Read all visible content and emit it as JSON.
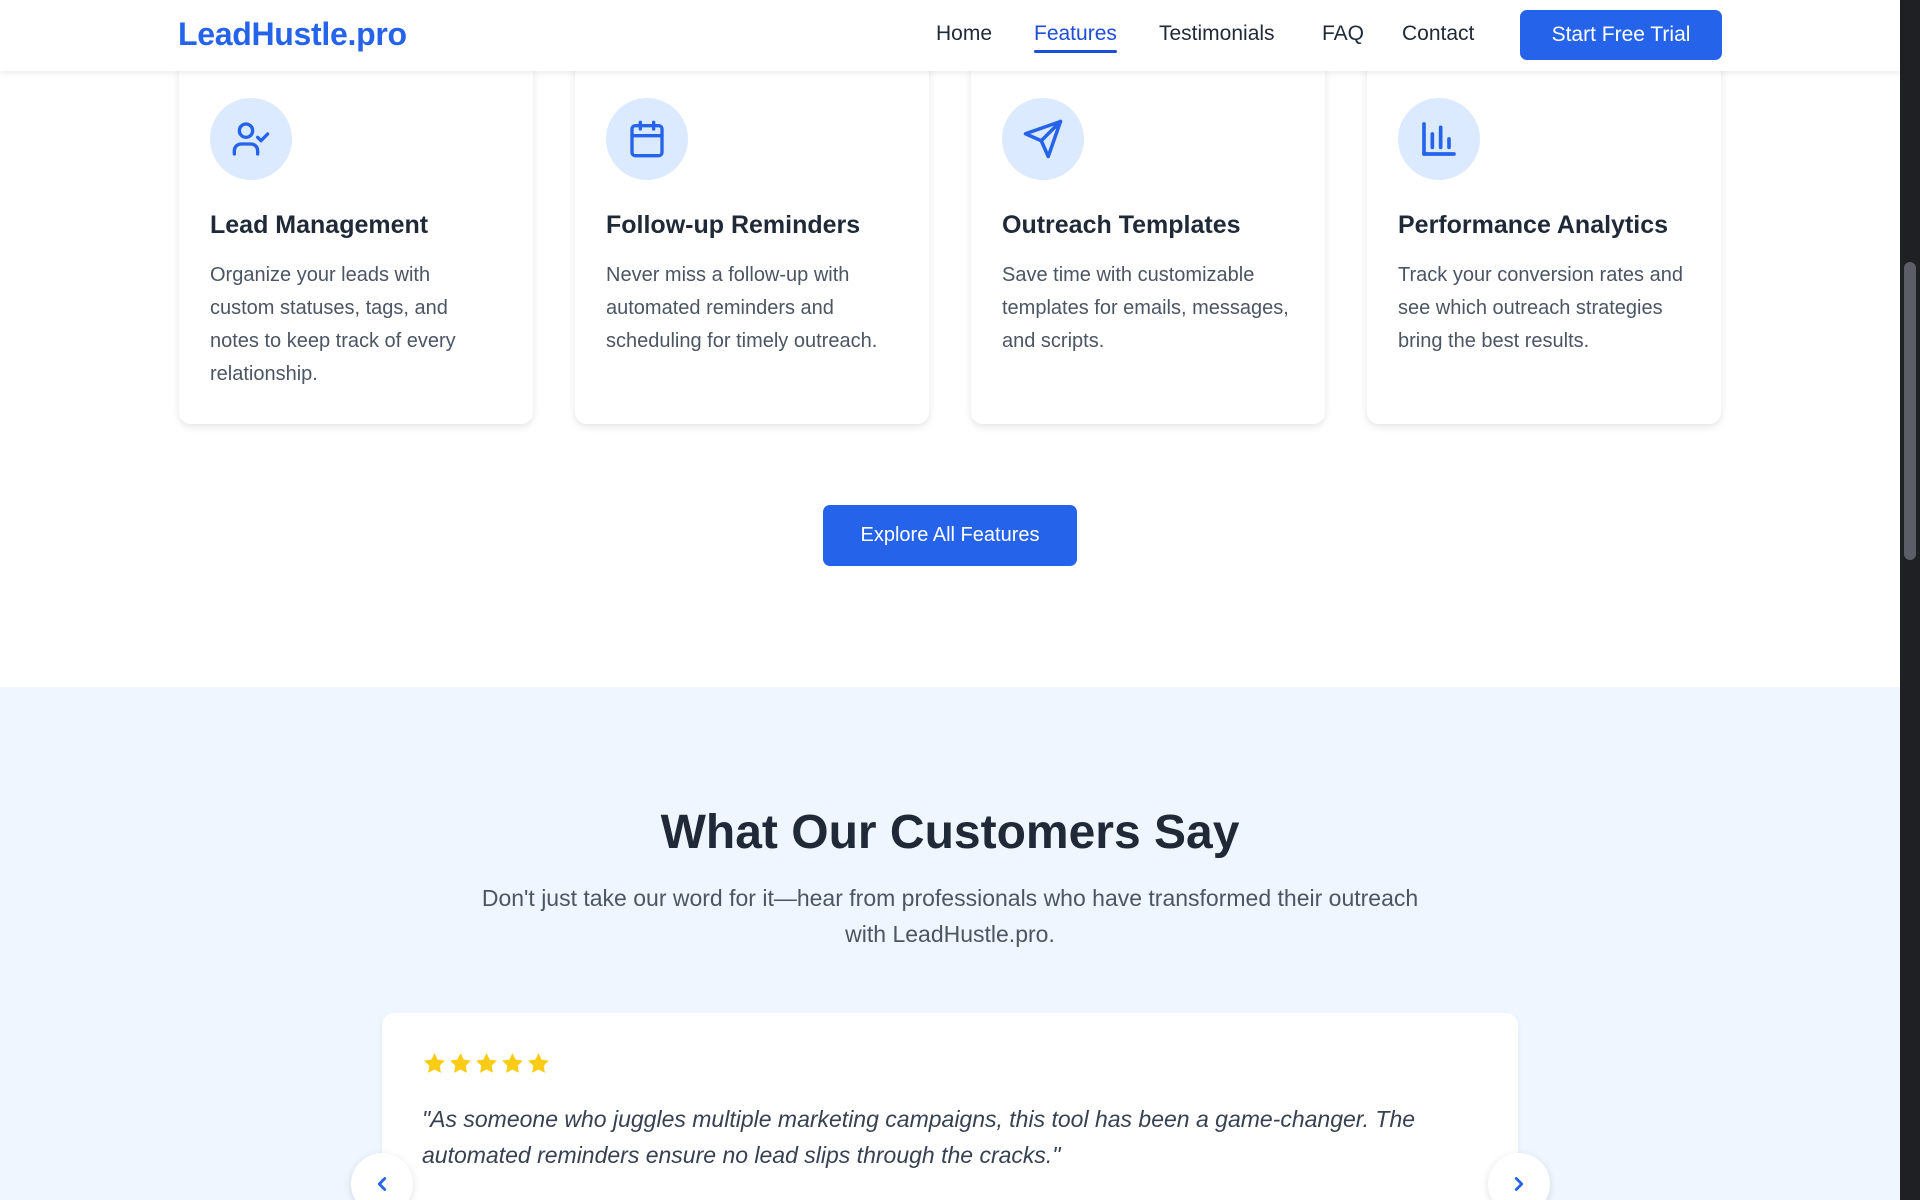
{
  "header": {
    "logo": "LeadHustle.pro",
    "nav": [
      "Home",
      "Features",
      "Testimonials",
      "FAQ",
      "Contact"
    ],
    "active_nav": "Features",
    "cta": "Start Free Trial"
  },
  "features": {
    "cards": [
      {
        "icon": "user-check-icon",
        "title": "Lead Management",
        "description": "Organize your leads with custom statuses, tags, and notes to keep track of every relationship."
      },
      {
        "icon": "calendar-icon",
        "title": "Follow-up Reminders",
        "description": "Never miss a follow-up with automated reminders and scheduling for timely outreach."
      },
      {
        "icon": "send-icon",
        "title": "Outreach Templates",
        "description": "Save time with customizable templates for emails, messages, and scripts."
      },
      {
        "icon": "bar-chart-icon",
        "title": "Performance Analytics",
        "description": "Track your conversion rates and see which outreach strategies bring the best results."
      }
    ],
    "explore_button": "Explore All Features"
  },
  "testimonials": {
    "heading": "What Our Customers Say",
    "subheading": "Don't just take our word for it—hear from professionals who have transformed their outreach with LeadHustle.pro.",
    "current": {
      "rating": 5,
      "quote": "\"As someone who juggles multiple marketing campaigns, this tool has been a game-changer. The automated reminders ensure no lead slips through the cracks.\""
    }
  },
  "colors": {
    "accent": "#2563eb",
    "icon_bg": "#dbeafe",
    "section_bg": "#eff6ff",
    "star": "#facc15"
  }
}
